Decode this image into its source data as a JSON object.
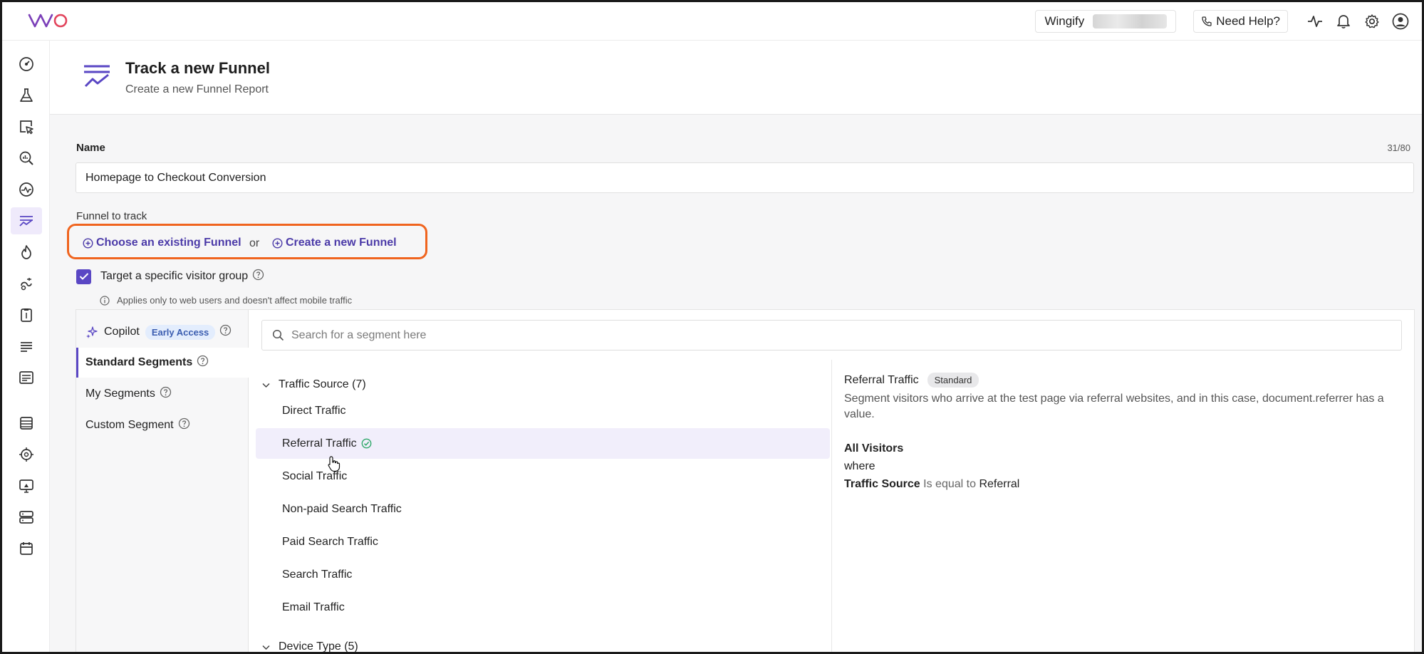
{
  "app": {
    "brand": "VWO"
  },
  "topbar": {
    "account_name": "Wingify",
    "help_label": "Need Help?",
    "icons": [
      "activity-icon",
      "bell-icon",
      "gear-icon",
      "user-avatar-icon"
    ]
  },
  "rail": {
    "items": [
      "dashboard-icon",
      "flask-icon",
      "cursor-click-icon",
      "zoom-insights-icon",
      "pulse-icon",
      "funnel-icon",
      "flame-icon",
      "hand-pointer-icon",
      "survey-icon",
      "list-icon",
      "form-icon",
      "table-icon",
      "target-icon",
      "monitor-icon",
      "server-icon",
      "calendar-icon"
    ],
    "active_index": 5
  },
  "header": {
    "title": "Track a new Funnel",
    "subtitle": "Create a new Funnel Report"
  },
  "form": {
    "name_label": "Name",
    "name_value": "Homepage to Checkout Conversion",
    "char_count": "31/80",
    "funnel_label": "Funnel to track",
    "choose_existing": "Choose an existing Funnel",
    "or_text": "or",
    "create_new": "Create a new Funnel",
    "target_label": "Target a specific visitor group",
    "target_checked": true,
    "note": "Applies only to web users and doesn't affect mobile traffic"
  },
  "segments": {
    "tabs": [
      {
        "label": "Copilot",
        "badge": "Early Access"
      },
      {
        "label": "Standard Segments"
      },
      {
        "label": "My Segments"
      },
      {
        "label": "Custom Segment"
      }
    ],
    "active_tab": 1,
    "search_placeholder": "Search for a segment here",
    "groups": [
      {
        "label": "Traffic Source (7)",
        "items": [
          "Direct Traffic",
          "Referral Traffic",
          "Social Traffic",
          "Non-paid Search Traffic",
          "Paid Search Traffic",
          "Search Traffic",
          "Email Traffic"
        ]
      },
      {
        "label": "Device Type (5)"
      }
    ],
    "selected_item": "Referral Traffic",
    "detail": {
      "title": "Referral Traffic",
      "badge": "Standard",
      "description": "Segment visitors who arrive at the test page via referral websites, and in this case, document.referrer has a value.",
      "audience": "All Visitors",
      "where": "where",
      "field": "Traffic Source",
      "operator": "Is equal to",
      "value": "Referral"
    }
  },
  "colors": {
    "accent": "#5a47c4",
    "highlight_outline": "#f0641e",
    "link": "#4b3aa8"
  }
}
